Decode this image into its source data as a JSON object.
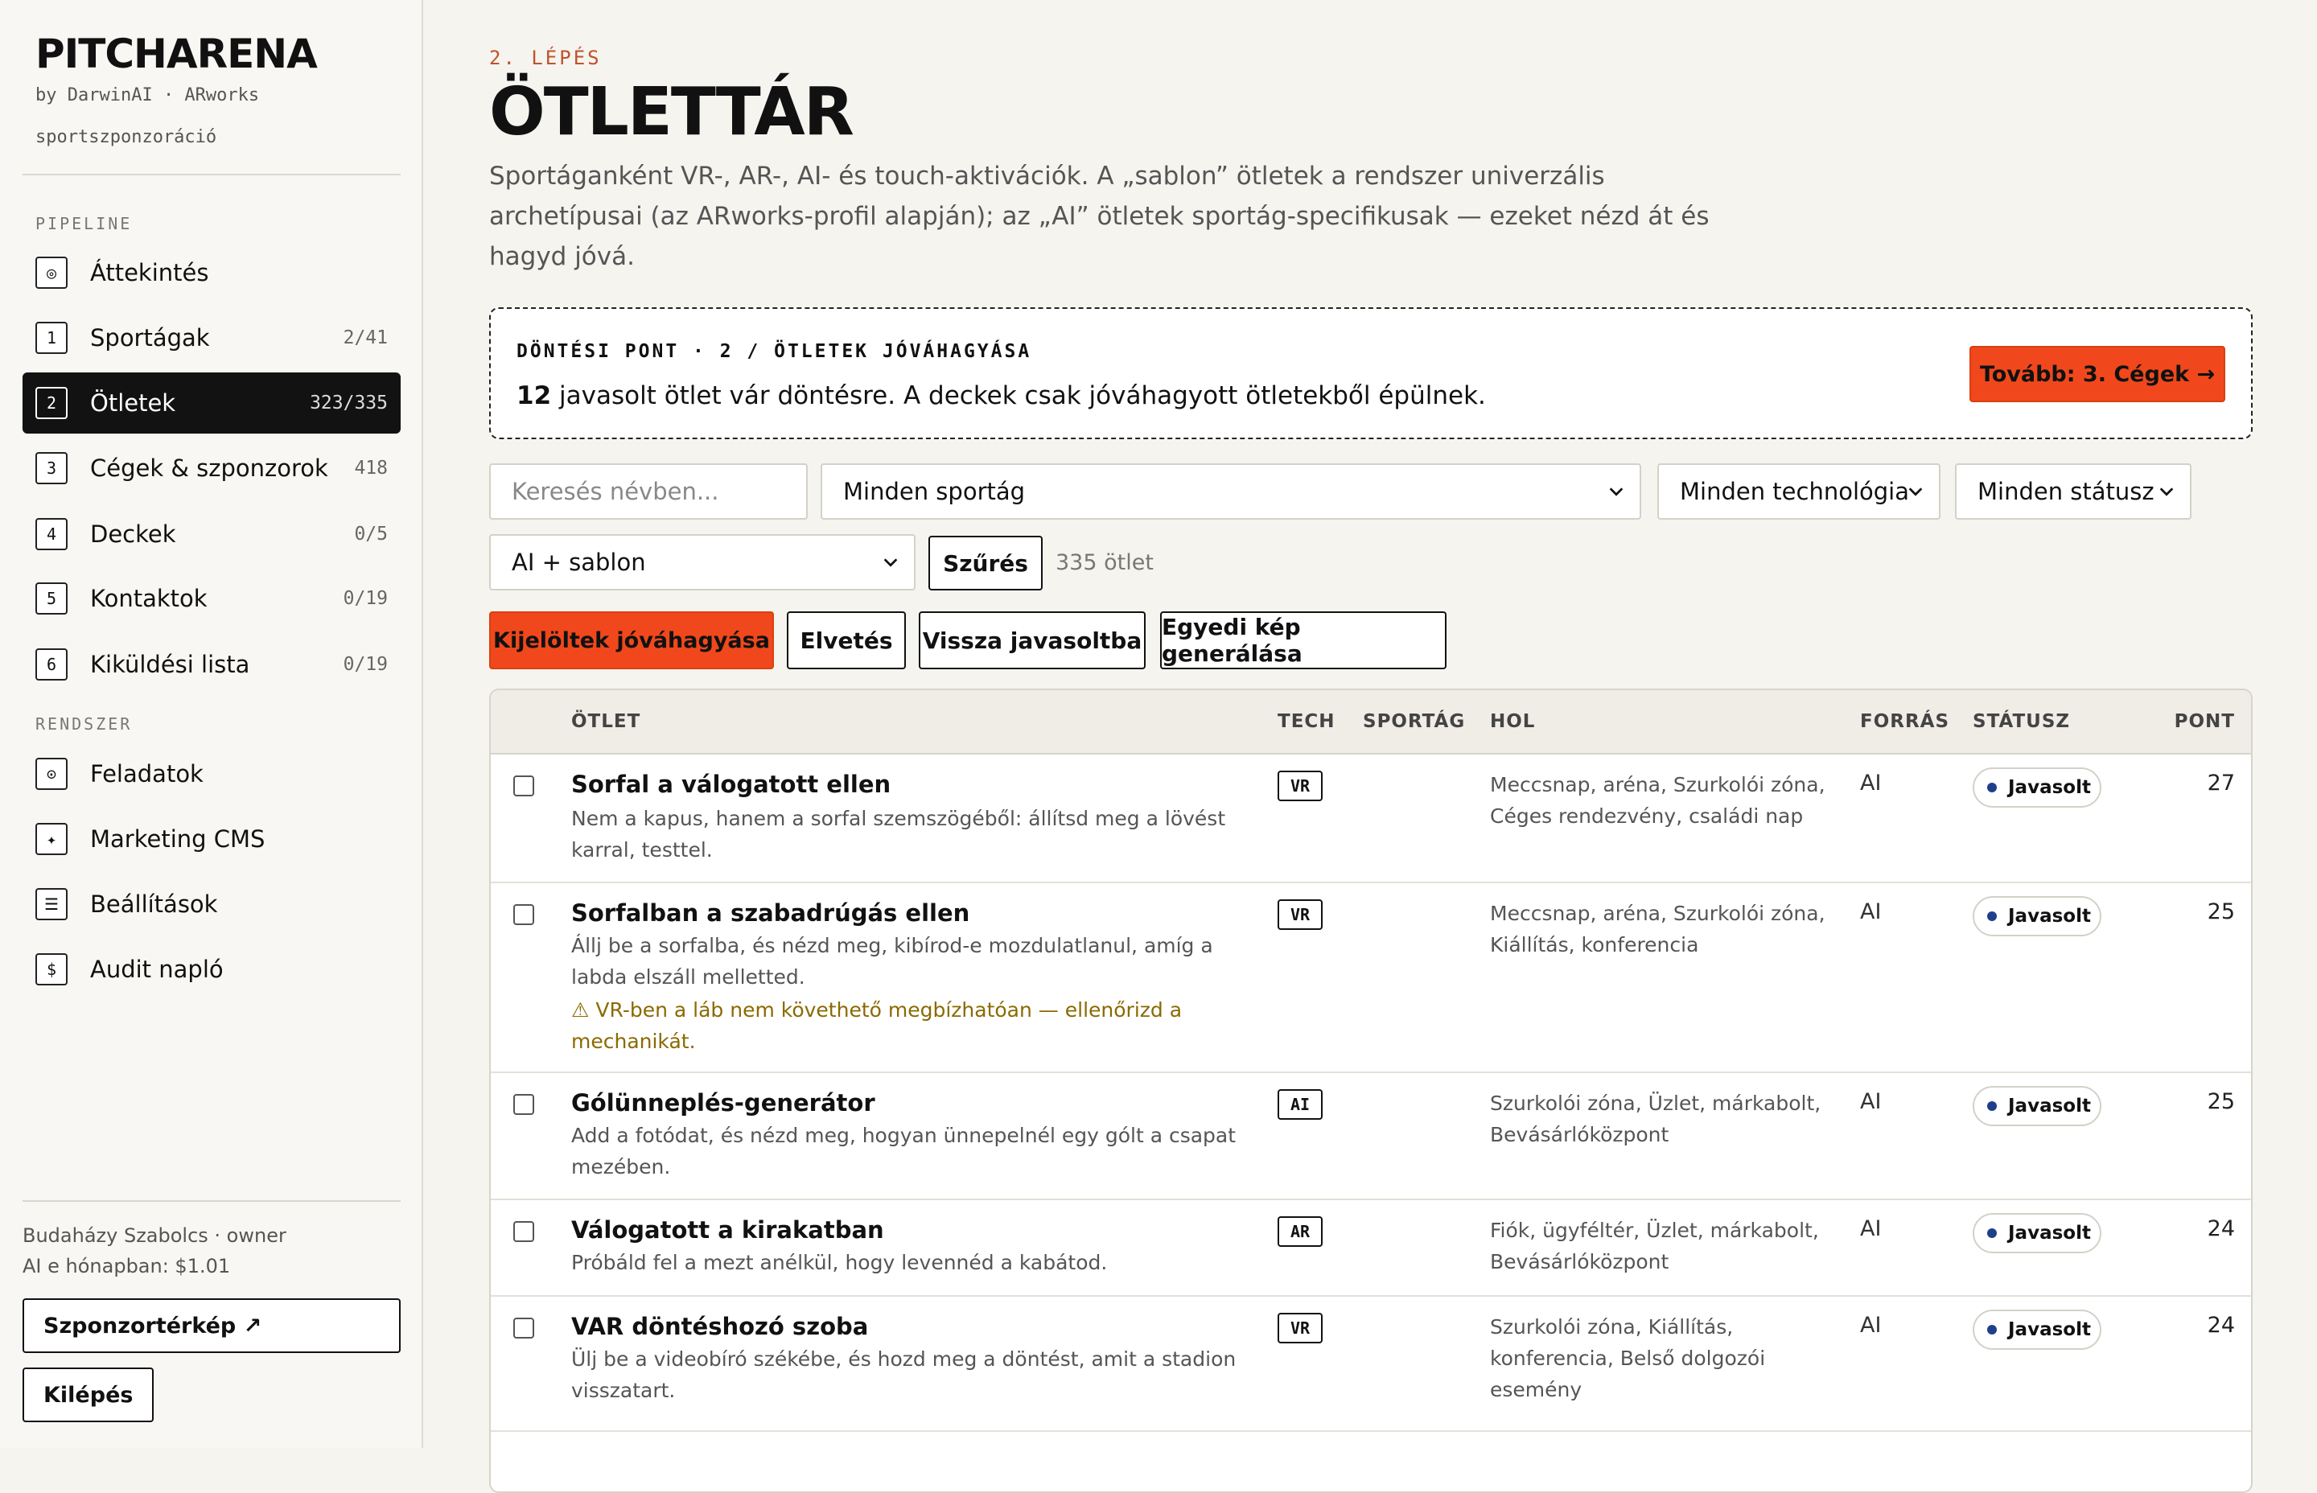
{
  "sidebar": {
    "brand": "PITCHARENA",
    "by": "by DarwinAI · ARworks",
    "tagline": "sportszponzoráció",
    "section_pipeline": "PIPELINE",
    "section_system": "RENDSZER",
    "items": [
      {
        "icon": "◎",
        "label": "Áttekintés",
        "count": ""
      },
      {
        "icon": "1",
        "label": "Sportágak",
        "count": "2/41"
      },
      {
        "icon": "2",
        "label": "Ötletek",
        "count": "323/335"
      },
      {
        "icon": "3",
        "label": "Cégek & szponzorok",
        "count": "418"
      },
      {
        "icon": "4",
        "label": "Deckek",
        "count": "0/5"
      },
      {
        "icon": "5",
        "label": "Kontaktok",
        "count": "0/19"
      },
      {
        "icon": "6",
        "label": "Kiküldési lista",
        "count": "0/19"
      }
    ],
    "system_items": [
      {
        "icon": "⊙",
        "label": "Feladatok"
      },
      {
        "icon": "✦",
        "label": "Marketing CMS"
      },
      {
        "icon": "☰",
        "label": "Beállítások"
      },
      {
        "icon": "$",
        "label": "Audit napló"
      }
    ],
    "user": "Budaházy Szabolcs · owner",
    "ai_cost": "AI e hónapban: $1.01",
    "map_button": "Szponzortérkép ↗",
    "logout_button": "Kilépés"
  },
  "header": {
    "step": "2. LÉPÉS",
    "title": "ÖTLETTÁR",
    "description": "Sportáganként VR-, AR-, AI- és touch-aktivációk. A „sablon” ötletek a rendszer univerzális archetípusai (az ARworks-profil alapján); az „AI” ötletek sportág-specifikusak — ezeket nézd át és hagyd jóvá."
  },
  "decision": {
    "label": "DÖNTÉSI PONT · 2 / ÖTLETEK JÓVÁHAGYÁSA",
    "count": "12",
    "text": "javasolt ötlet vár döntésre. A deckek csak jóváhagyott ötletekből épülnek.",
    "next_button": "Tovább: 3. Cégek →"
  },
  "filters": {
    "search_placeholder": "Keresés névben...",
    "sport": "Minden sportág",
    "technology": "Minden technológia",
    "status": "Minden státusz",
    "source": "AI + sablon",
    "filter_button": "Szűrés",
    "result_count": "335 ötlet"
  },
  "actions": {
    "approve": "Kijelöltek jóváhagyása",
    "reject": "Elvetés",
    "back_to_suggested": "Vissza javasoltba",
    "generate_image": "Egyedi kép generálása"
  },
  "table": {
    "columns": [
      "ÖTLET",
      "TECH",
      "SPORTÁG",
      "HOL",
      "FORRÁS",
      "STÁTUSZ",
      "PONT"
    ],
    "rows": [
      {
        "title": "Sorfal a válogatott ellen",
        "desc": "Nem a kapus, hanem a sorfal szemszögéből: állítsd meg a lövést karral, testtel.",
        "warn": "",
        "tech": "VR",
        "hol": "Meccsnap, aréna, Szurkolói zóna, Céges rendezvény, családi nap",
        "source": "AI",
        "status": "Javasolt",
        "score": "27"
      },
      {
        "title": "Sorfalban a szabadrúgás ellen",
        "desc": "Állj be a sorfalba, és nézd meg, kibírod-e mozdulatlanul, amíg a labda elszáll melletted.",
        "warn": "⚠ VR-ben a láb nem követhető megbízhatóan — ellenőrizd a mechanikát.",
        "tech": "VR",
        "hol": "Meccsnap, aréna, Szurkolói zóna, Kiállítás, konferencia",
        "source": "AI",
        "status": "Javasolt",
        "score": "25"
      },
      {
        "title": "Gólünneplés-generátor",
        "desc": "Add a fotódat, és nézd meg, hogyan ünnepelnél egy gólt a csapat mezében.",
        "warn": "",
        "tech": "AI",
        "hol": "Szurkolói zóna, Üzlet, márkabolt, Bevásárlóközpont",
        "source": "AI",
        "status": "Javasolt",
        "score": "25"
      },
      {
        "title": "Válogatott a kirakatban",
        "desc": "Próbáld fel a mezt anélkül, hogy levennéd a kabátod.",
        "warn": "",
        "tech": "AR",
        "hol": "Fiók, ügyféltér, Üzlet, márkabolt, Bevásárlóközpont",
        "source": "AI",
        "status": "Javasolt",
        "score": "24"
      },
      {
        "title": "VAR döntéshozó szoba",
        "desc": "Ülj be a videobíró székébe, és hozd meg a döntést, amit a stadion visszatart.",
        "warn": "",
        "tech": "VR",
        "hol": "Szurkolói zóna, Kiállítás, konferencia, Belső dolgozói esemény",
        "source": "AI",
        "status": "Javasolt",
        "score": "24"
      }
    ]
  },
  "colors": {
    "accent": "#f0481c",
    "status_dot": "#1f3f8a",
    "warning": "#8a6a00"
  }
}
